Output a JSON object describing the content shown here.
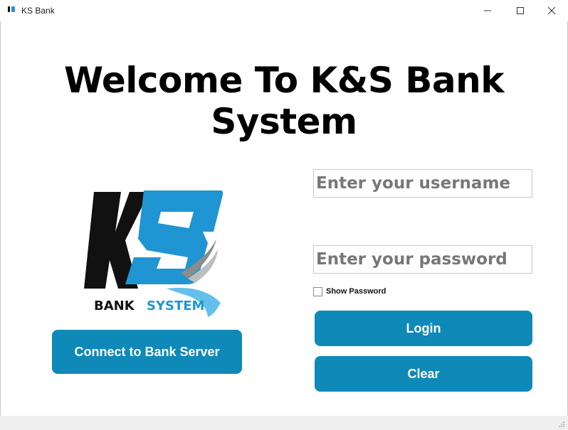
{
  "window": {
    "title": "KS Bank",
    "icon": "ks-bank-app-icon",
    "controls": [
      "minimize-icon",
      "maximize-icon",
      "close-icon"
    ]
  },
  "heading": "Welcome To K&S Bank System",
  "logo": {
    "letters": "KS",
    "bank_text": "BANK",
    "system_text": "SYSTEM",
    "colors": {
      "k": "#111111",
      "s": "#1f95d3",
      "system": "#1f95d3"
    }
  },
  "login": {
    "username_placeholder": "Enter your username",
    "password_placeholder": "Enter your password",
    "show_password_label": "Show Password",
    "show_password_checked": false,
    "login_label": "Login",
    "clear_label": "Clear"
  },
  "connect_label": "Connect to Bank Server",
  "colors": {
    "button": "#0f89b7",
    "button_text": "#ffffff"
  }
}
